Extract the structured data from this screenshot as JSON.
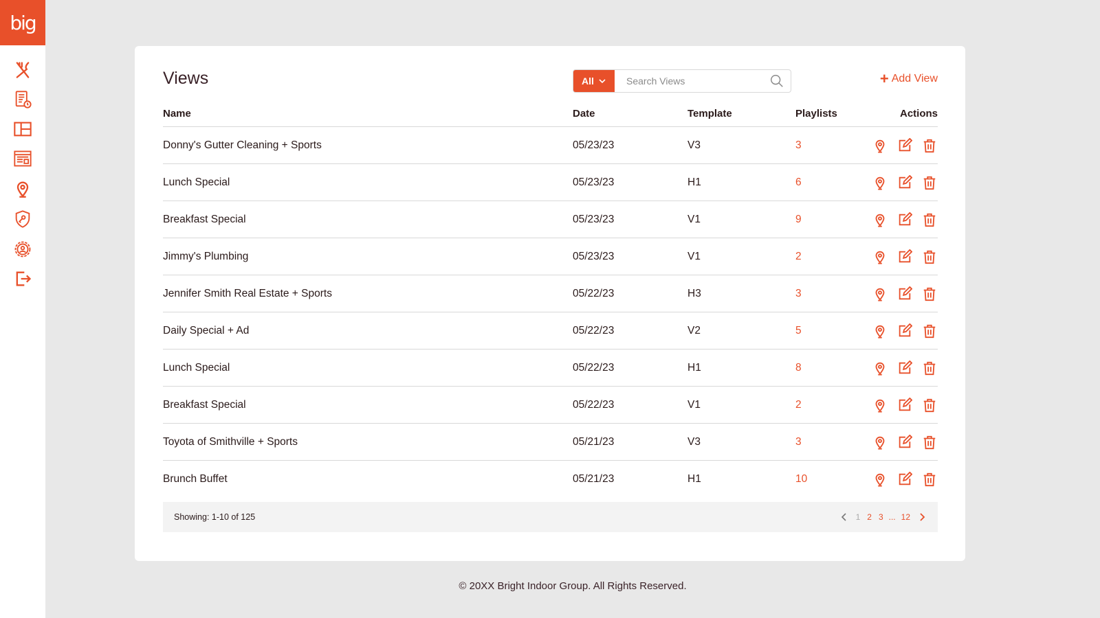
{
  "brand": {
    "logo_text": "big",
    "accent": "#e8502a"
  },
  "sidebar": {
    "items": [
      {
        "name": "sidebar-item-menu",
        "icon": "utensils-icon"
      },
      {
        "name": "sidebar-item-schedule",
        "icon": "document-clock-icon"
      },
      {
        "name": "sidebar-item-layouts",
        "icon": "layout-icon"
      },
      {
        "name": "sidebar-item-views",
        "icon": "newspaper-icon"
      },
      {
        "name": "sidebar-item-locations",
        "icon": "location-pin-icon"
      },
      {
        "name": "sidebar-item-security",
        "icon": "shield-key-icon"
      },
      {
        "name": "sidebar-item-account",
        "icon": "user-gear-icon"
      },
      {
        "name": "sidebar-item-logout",
        "icon": "logout-icon"
      }
    ]
  },
  "header": {
    "title": "Views",
    "filter_label": "All",
    "search_placeholder": "Search Views",
    "add_label": "Add View"
  },
  "table": {
    "columns": [
      "Name",
      "Date",
      "Template",
      "Playlists",
      "Actions"
    ],
    "rows": [
      {
        "name": "Donny's Gutter Cleaning + Sports",
        "date": "05/23/23",
        "template": "V3",
        "playlists": "3"
      },
      {
        "name": "Lunch Special",
        "date": "05/23/23",
        "template": "H1",
        "playlists": "6"
      },
      {
        "name": "Breakfast Special",
        "date": "05/23/23",
        "template": "V1",
        "playlists": "9"
      },
      {
        "name": "Jimmy's Plumbing",
        "date": "05/23/23",
        "template": "V1",
        "playlists": "2"
      },
      {
        "name": "Jennifer Smith Real Estate + Sports",
        "date": "05/22/23",
        "template": "H3",
        "playlists": "3"
      },
      {
        "name": "Daily Special + Ad",
        "date": "05/22/23",
        "template": "V2",
        "playlists": "5"
      },
      {
        "name": "Lunch Special",
        "date": "05/22/23",
        "template": "H1",
        "playlists": "8"
      },
      {
        "name": "Breakfast Special",
        "date": "05/22/23",
        "template": "V1",
        "playlists": "2"
      },
      {
        "name": "Toyota of Smithville + Sports",
        "date": "05/21/23",
        "template": "V3",
        "playlists": "3"
      },
      {
        "name": "Brunch Buffet",
        "date": "05/21/23",
        "template": "H1",
        "playlists": "10"
      }
    ]
  },
  "pagination": {
    "showing": "Showing: 1-10 of 125",
    "pages": [
      "1",
      "2",
      "3",
      "12"
    ],
    "ellipsis": "...",
    "current": "1"
  },
  "footer": {
    "copyright": "© 20XX Bright Indoor Group. All Rights Reserved."
  }
}
